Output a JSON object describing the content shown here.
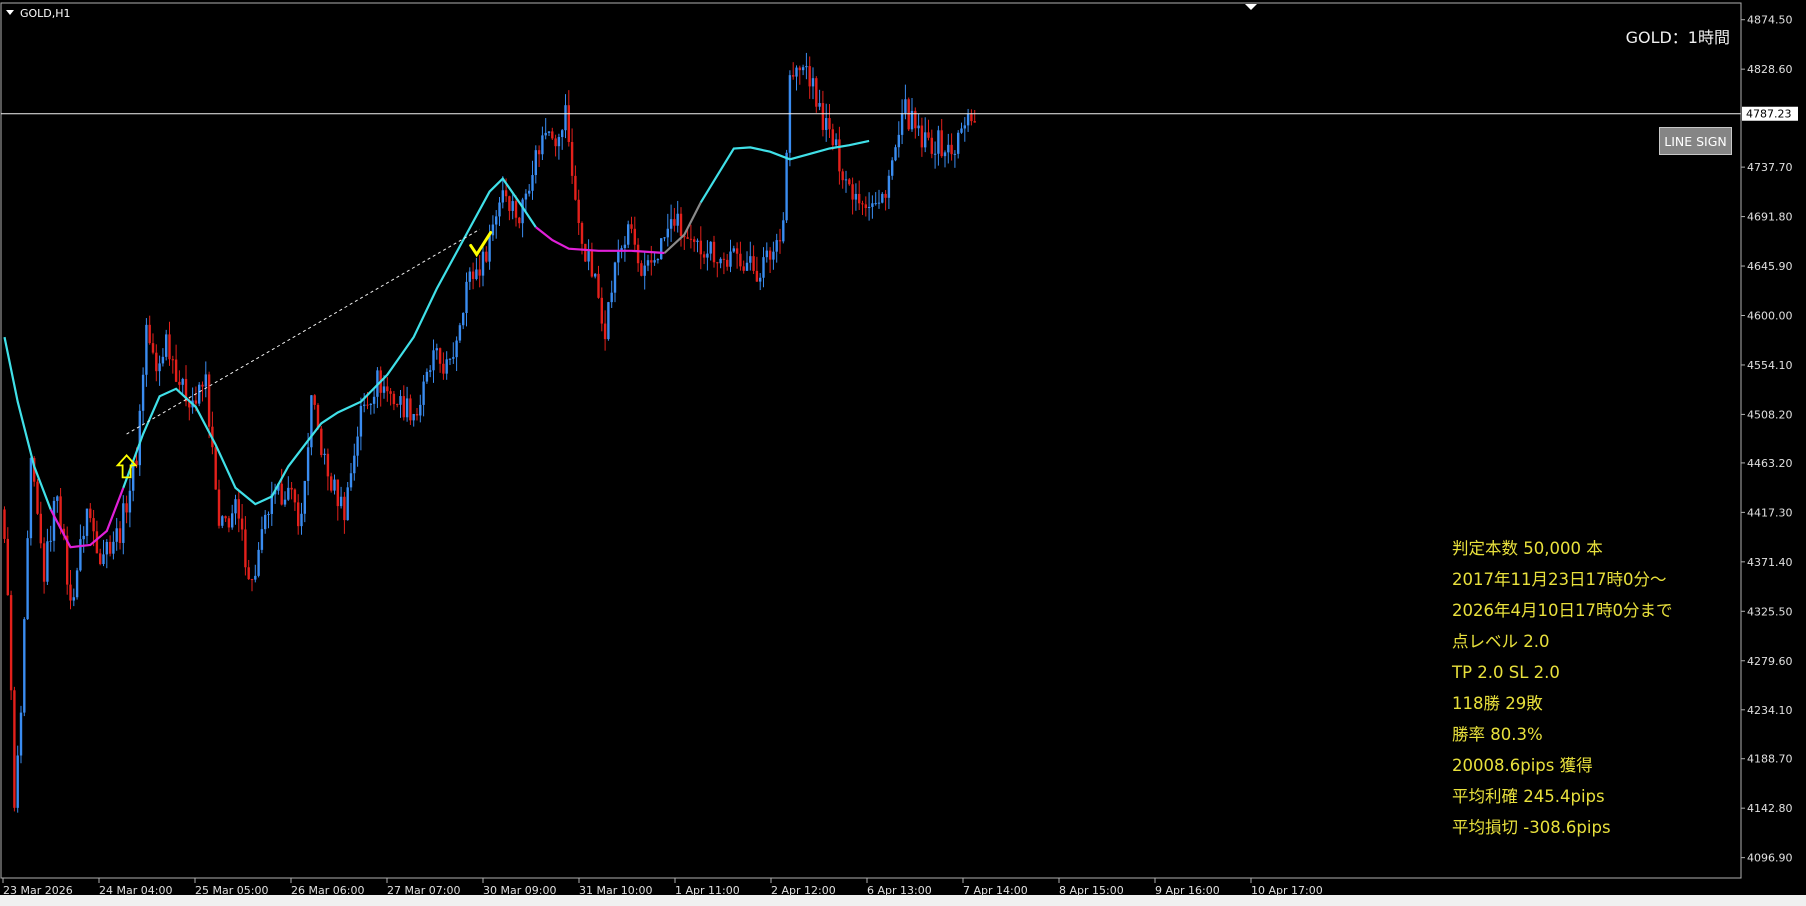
{
  "window": {
    "symbol_label": "GOLD,H1",
    "chart_title": "GOLD：1時間"
  },
  "buttons": {
    "line_sign": "LINE SIGN"
  },
  "price_line": {
    "label": "4787.23"
  },
  "price_axis": {
    "ticks": [
      "4874.50",
      "4828.60",
      "4787.23",
      "4737.70",
      "4691.80",
      "4645.90",
      "4600.00",
      "4554.10",
      "4508.20",
      "4463.20",
      "4417.30",
      "4371.40",
      "4325.50",
      "4279.60",
      "4234.10",
      "4188.70",
      "4142.80",
      "4096.90"
    ]
  },
  "time_axis": {
    "labels": [
      "23 Mar 2026",
      "24 Mar 04:00",
      "25 Mar 05:00",
      "26 Mar 06:00",
      "27 Mar 07:00",
      "30 Mar 09:00",
      "31 Mar 10:00",
      "1 Apr 11:00",
      "2 Apr 12:00",
      "6 Apr 13:00",
      "7 Apr 14:00",
      "8 Apr 15:00",
      "9 Apr 16:00",
      "10 Apr 17:00"
    ]
  },
  "stats": [
    "判定本数 50,000 本",
    "2017年11月23日17時0分～",
    "2026年4月10日17時0分まで",
    "点レベル 2.0",
    "TP 2.0 SL 2.0",
    "118勝 29敗",
    "勝率 80.3%",
    "20008.6pips 獲得",
    "平均利確 245.4pips",
    "平均損切 -308.6pips"
  ],
  "colors": {
    "bull": "#3a8cf0",
    "bear": "#e3201b",
    "ma_up": "#40e0e8",
    "ma_down": "#e020d8",
    "ma_flat": "#8a8a8a",
    "signal": "#ffff00",
    "stats_text": "#e8e03c"
  },
  "chart_data": {
    "type": "candlestick",
    "symbol": "GOLD",
    "timeframe": "H1",
    "ylim": [
      4078,
      4890
    ],
    "last_price": 4787.23,
    "anchors": [
      [
        0,
        4420
      ],
      [
        2,
        4350
      ],
      [
        4,
        4140
      ],
      [
        6,
        4230
      ],
      [
        9,
        4460
      ],
      [
        13,
        4360
      ],
      [
        17,
        4440
      ],
      [
        21,
        4330
      ],
      [
        26,
        4420
      ],
      [
        30,
        4380
      ],
      [
        36,
        4400
      ],
      [
        41,
        4470
      ],
      [
        44,
        4590
      ],
      [
        47,
        4545
      ],
      [
        50,
        4580
      ],
      [
        55,
        4530
      ],
      [
        59,
        4520
      ],
      [
        62,
        4540
      ],
      [
        66,
        4400
      ],
      [
        71,
        4420
      ],
      [
        76,
        4350
      ],
      [
        81,
        4420
      ],
      [
        86,
        4440
      ],
      [
        91,
        4410
      ],
      [
        94,
        4520
      ],
      [
        99,
        4450
      ],
      [
        104,
        4420
      ],
      [
        109,
        4510
      ],
      [
        114,
        4540
      ],
      [
        120,
        4520
      ],
      [
        126,
        4510
      ],
      [
        131,
        4560
      ],
      [
        136,
        4550
      ],
      [
        141,
        4630
      ],
      [
        146,
        4650
      ],
      [
        152,
        4720
      ],
      [
        157,
        4690
      ],
      [
        161,
        4740
      ],
      [
        166,
        4780
      ],
      [
        169,
        4760
      ],
      [
        171,
        4790
      ],
      [
        175,
        4680
      ],
      [
        180,
        4630
      ],
      [
        183,
        4590
      ],
      [
        187,
        4660
      ],
      [
        191,
        4680
      ],
      [
        194,
        4630
      ],
      [
        199,
        4660
      ],
      [
        204,
        4690
      ],
      [
        209,
        4660
      ],
      [
        214,
        4665
      ],
      [
        219,
        4650
      ],
      [
        224,
        4655
      ],
      [
        229,
        4640
      ],
      [
        234,
        4660
      ],
      [
        237,
        4690
      ],
      [
        239,
        4820
      ],
      [
        244,
        4830
      ],
      [
        248,
        4790
      ],
      [
        252,
        4760
      ],
      [
        257,
        4720
      ],
      [
        261,
        4710
      ],
      [
        266,
        4700
      ],
      [
        270,
        4740
      ],
      [
        274,
        4790
      ],
      [
        279,
        4760
      ],
      [
        284,
        4760
      ],
      [
        288,
        4750
      ],
      [
        291,
        4770
      ],
      [
        294,
        4787
      ]
    ],
    "moving_average": {
      "anchors": [
        [
          0,
          4580
        ],
        [
          4,
          4520
        ],
        [
          9,
          4460
        ],
        [
          14,
          4420
        ],
        [
          20,
          4385
        ],
        [
          26,
          4387
        ],
        [
          31,
          4400
        ],
        [
          36,
          4440
        ],
        [
          42,
          4490
        ],
        [
          47,
          4525
        ],
        [
          52,
          4532
        ],
        [
          58,
          4515
        ],
        [
          64,
          4480
        ],
        [
          70,
          4440
        ],
        [
          76,
          4425
        ],
        [
          81,
          4432
        ],
        [
          86,
          4460
        ],
        [
          91,
          4480
        ],
        [
          96,
          4500
        ],
        [
          101,
          4510
        ],
        [
          108,
          4520
        ],
        [
          116,
          4545
        ],
        [
          124,
          4580
        ],
        [
          131,
          4625
        ],
        [
          139,
          4670
        ],
        [
          147,
          4715
        ],
        [
          151,
          4727
        ],
        [
          156,
          4705
        ],
        [
          161,
          4682
        ],
        [
          166,
          4670
        ],
        [
          171,
          4662
        ],
        [
          180,
          4660
        ],
        [
          190,
          4660
        ],
        [
          200,
          4658
        ],
        [
          206,
          4675
        ],
        [
          211,
          4705
        ],
        [
          216,
          4730
        ],
        [
          221,
          4755
        ],
        [
          226,
          4756
        ],
        [
          232,
          4752
        ],
        [
          238,
          4745
        ],
        [
          244,
          4750
        ],
        [
          250,
          4755
        ],
        [
          256,
          4758
        ],
        [
          262,
          4762
        ]
      ],
      "segment_colors": [
        [
          "up",
          0,
          3
        ],
        [
          "down",
          3,
          7
        ],
        [
          "up",
          7,
          28
        ],
        [
          "down",
          28,
          33
        ],
        [
          "flat",
          33,
          35
        ],
        [
          "up",
          35,
          44
        ],
        [
          "down",
          44,
          47
        ],
        [
          "flat",
          47,
          50
        ],
        [
          "up",
          50,
          54
        ],
        [
          "flat",
          54,
          61
        ],
        [
          "up",
          61,
          62
        ]
      ]
    },
    "signals": [
      {
        "type": "arrow_up",
        "bar": 37,
        "price": 4460
      },
      {
        "type": "check",
        "bar": 144,
        "price": 4665
      }
    ],
    "trend_line": {
      "from": [
        37,
        4490
      ],
      "to": [
        144,
        4680
      ]
    }
  }
}
